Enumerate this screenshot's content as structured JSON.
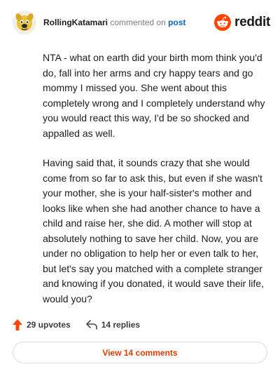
{
  "comment": {
    "author": "RollingKatamari",
    "action_text": "commented on",
    "target_link": "post",
    "paragraphs": [
      "NTA - what on earth did your birth mom think you'd do, fall into her arms and cry happy tears and go mommy I missed you. She went about this completely wrong and I completely understand why you would react this way, I'd be so shocked and appalled as well.",
      "Having said that, it sounds crazy that she would come from so far to ask this, but even if she wasn't your mother, she is your half-sister's mother and looks like when she had another chance to have a child and raise her, she did. A mother will stop at absolutely nothing to save her child. Now, you are under no obligation to help her or even talk to her, but let's say you matched with a complete stranger and knowing if you donated, it would save their life, would you?"
    ]
  },
  "brand": {
    "wordmark": "reddit",
    "icon": "reddit-snoo-icon",
    "color": "#ff4500"
  },
  "footer": {
    "upvotes_label": "29 upvotes",
    "replies_label": "14 replies",
    "upvote_icon": "upvote-arrow-icon",
    "reply_icon": "reply-arrow-icon",
    "upvote_color": "#ff4500"
  },
  "view_button": {
    "label": "View 14 comments",
    "color": "#e03a00"
  }
}
